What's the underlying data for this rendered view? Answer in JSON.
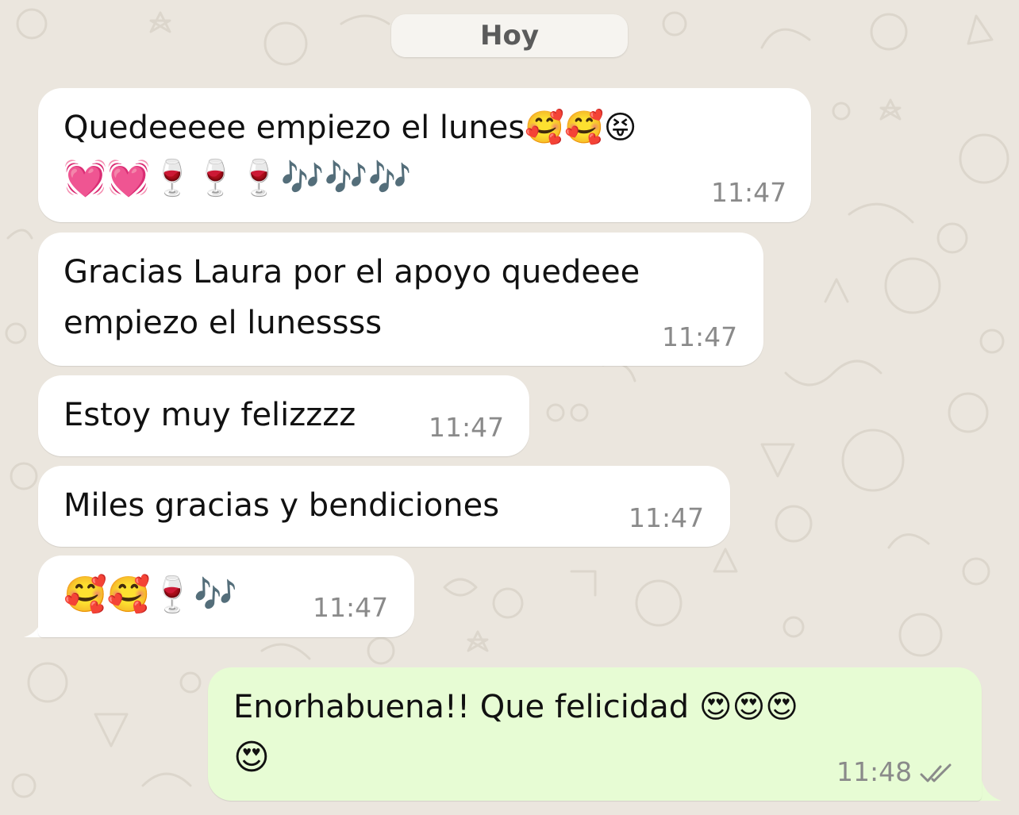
{
  "chat": {
    "date_label": "Hoy",
    "messages": [
      {
        "direction": "in",
        "lines": [
          "Quedeeeee empiezo el lunes🥰🥰😝",
          "💓💓🍷🍷🍷🎶🎶🎶"
        ],
        "time": "11:47"
      },
      {
        "direction": "in",
        "lines": [
          "Gracias Laura por el apoyo quedeee",
          "empiezo el lunessss"
        ],
        "time": "11:47"
      },
      {
        "direction": "in",
        "lines": [
          "Estoy muy felizzzz"
        ],
        "time": "11:47"
      },
      {
        "direction": "in",
        "lines": [
          "Miles gracias y bendiciones"
        ],
        "time": "11:47"
      },
      {
        "direction": "in",
        "lines": [
          "🥰🥰🍷🎶"
        ],
        "time": "11:47"
      },
      {
        "direction": "out",
        "lines": [
          "Enorhabuena!! Que felicidad 😍😍😍",
          "😍"
        ],
        "time": "11:48",
        "status": "read-double-check-icon"
      }
    ]
  },
  "colors": {
    "wallpaper": "#ebe6de",
    "incoming_bubble": "#ffffff",
    "outgoing_bubble": "#e7fcd4",
    "timestamp": "#8a8a8a",
    "date_chip": "#f6f4f0"
  }
}
